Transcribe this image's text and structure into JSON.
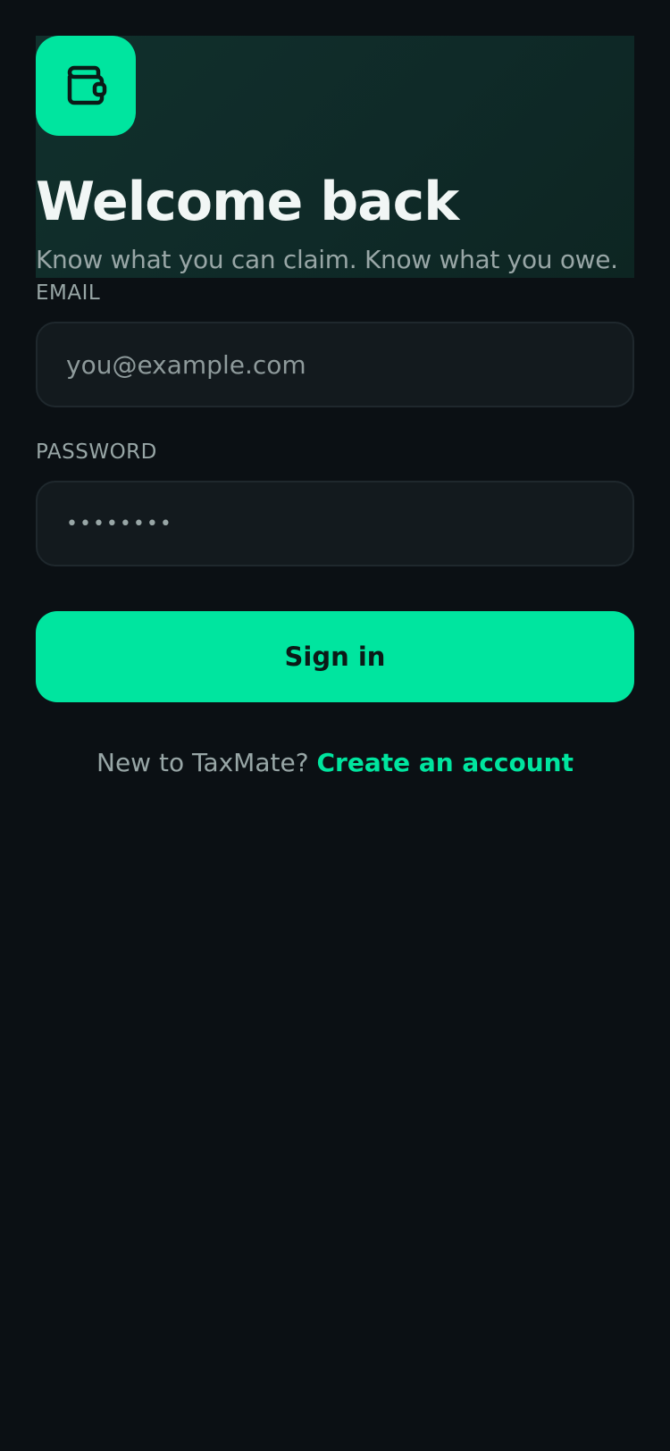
{
  "brand": {
    "accent_color": "#00e59f",
    "background_color": "#0b1014",
    "logo_icon": "wallet-icon"
  },
  "header": {
    "title": "Welcome back",
    "subtitle": "Know what you can claim. Know what you owe."
  },
  "form": {
    "email": {
      "label": "EMAIL",
      "placeholder": "you@example.com",
      "value": ""
    },
    "password": {
      "label": "PASSWORD",
      "value": "••••••••"
    },
    "submit_label": "Sign in"
  },
  "footer": {
    "prompt": "New to TaxMate?",
    "link_label": "Create an account"
  }
}
